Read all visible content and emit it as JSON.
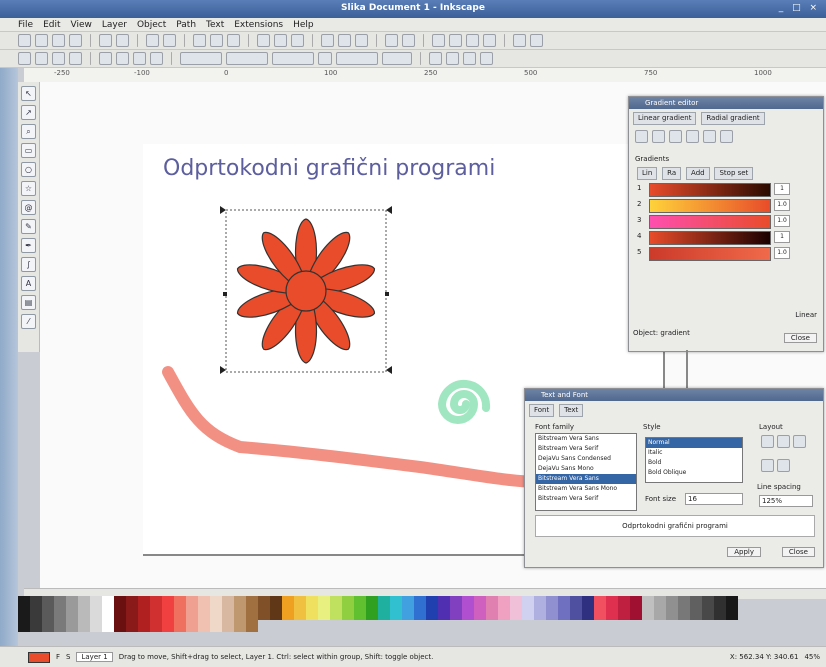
{
  "window": {
    "title": "Slika Document 1 - Inkscape",
    "controls": "_ □ ×"
  },
  "menu": [
    "File",
    "Edit",
    "View",
    "Layer",
    "Object",
    "Path",
    "Text",
    "Extensions",
    "Help"
  ],
  "canvas": {
    "heading": "Odprtokodni grafični programi"
  },
  "ruler": {
    "ticks": [
      "-250",
      "-100",
      "0",
      "100",
      "250",
      "500",
      "750",
      "1000"
    ]
  },
  "tools": [
    "select-tool",
    "node-tool",
    "zoom-tool",
    "rect-tool",
    "circle-tool",
    "star-tool",
    "spiral-tool",
    "pencil-tool",
    "pen-tool",
    "callig-tool",
    "text-tool",
    "gradient-tool",
    "dropper-tool"
  ],
  "gradient_dialog": {
    "title": "Gradient editor",
    "tabs": [
      "Linear gradient",
      "Radial gradient"
    ],
    "section_label": "Gradients",
    "subtabs": [
      "Lin",
      "Ra",
      "Add",
      "Stop set"
    ],
    "gradients": [
      {
        "label": "1",
        "colors": "#e84c2a,#2a0a00"
      },
      {
        "label": "2",
        "colors": "#ffd23a,#e84c2a"
      },
      {
        "label": "3",
        "colors": "#ff4fb0,#e84c2a"
      },
      {
        "label": "4",
        "colors": "#e84c2a,#1a0000"
      },
      {
        "label": "5",
        "colors": "#cc3a2a,#f06a4a"
      }
    ],
    "spin_values": [
      "1",
      "1.0",
      "1.0",
      "1",
      "1.0"
    ],
    "footer_left": "Object: gradient",
    "footer_right": "Linear",
    "apply": "Close"
  },
  "text_dialog": {
    "title": "Text and Font",
    "tabs": [
      "Font",
      "Text"
    ],
    "family_label": "Font family",
    "families": [
      "Bitstream Vera Sans",
      "Bitstream Vera Serif",
      "DejaVu Sans Condensed",
      "DejaVu Sans Mono",
      "Bitstream Vera Sans",
      "Bitstream Vera Sans Mono",
      "Bitstream Vera Serif"
    ],
    "selected_family_index": 4,
    "style_label": "Style",
    "styles": [
      "Normal",
      "Italic",
      "Bold",
      "Bold Oblique"
    ],
    "selected_style_index": 0,
    "size_label": "Font size",
    "size_value": "16",
    "layout_label": "Layout",
    "spacing_label": "Line spacing",
    "spacing_value": "125%",
    "preview": "Odprtokodni grafični programi",
    "apply": "Apply",
    "close": "Close"
  },
  "status": {
    "fill_label": "F",
    "stroke_label": "S",
    "layer": "Layer 1",
    "message": "Drag to move, Shift+drag to select, Layer 1. Ctrl: select within group, Shift: toggle object.",
    "coords": "X: 562.34 Y: 340.61",
    "zoom": "45%"
  },
  "colors": {
    "flower": "#e84c2a",
    "stroke": "#333333",
    "brush": "#f07c6e",
    "spiral": "#a0e6c0",
    "heading": "#5c5e9e"
  },
  "palette": [
    "#1a1a1a",
    "#3a3a3a",
    "#5a5a5a",
    "#7a7a7a",
    "#9a9a9a",
    "#bababa",
    "#dadada",
    "#ffffff",
    "#6b1010",
    "#8a1a1a",
    "#b02020",
    "#d03030",
    "#f04040",
    "#f07060",
    "#f0a090",
    "#f0c0b0",
    "#f0d8c8",
    "#d8b8a0",
    "#c09870",
    "#a07040",
    "#805028",
    "#603818",
    "#f0a020",
    "#f0c040",
    "#f0e060",
    "#e8f080",
    "#c0e060",
    "#90d040",
    "#60c030",
    "#30a020",
    "#20b0a0",
    "#30c0d0",
    "#40a0e0",
    "#3070d0",
    "#2040b0",
    "#5030b0",
    "#8040c0",
    "#b050d0",
    "#d060c0",
    "#e080b0",
    "#f0a0c0",
    "#f0c0d8",
    "#d0d0f0",
    "#b0b0e0",
    "#9090d0",
    "#7070c0",
    "#5050a0",
    "#303080",
    "#f05060",
    "#e03050",
    "#c02040",
    "#a01030",
    "#c0c0c0",
    "#a8a8a8",
    "#909090",
    "#787878",
    "#606060",
    "#484848",
    "#303030",
    "#181818"
  ]
}
